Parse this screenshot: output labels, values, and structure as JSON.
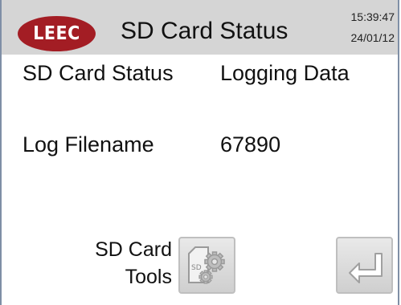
{
  "header": {
    "logo_text": "LEEC",
    "title": "SD Card Status",
    "time": "15:39:47",
    "date": "24/01/12"
  },
  "status": {
    "sd_card_status_label": "SD Card Status",
    "sd_card_status_value": "Logging Data",
    "log_filename_label": "Log Filename",
    "log_filename_value": "67890"
  },
  "footer": {
    "tools_line1": "SD Card",
    "tools_line2": "Tools",
    "sd_icon_text": "SD",
    "tools_icon": "sd-card-gear-icon",
    "return_icon": "return-arrow-icon"
  },
  "colors": {
    "header_bg": "#d5d5d5",
    "logo_red": "#a31d24",
    "button_bg": "#dcdcdc"
  }
}
